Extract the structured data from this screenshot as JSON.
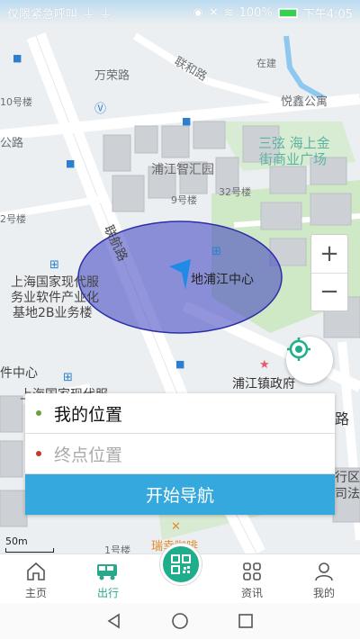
{
  "status_bar": {
    "left_text": "仅限紧急呼叫",
    "battery": "100%",
    "time": "下午4:05"
  },
  "map": {
    "labels": {
      "wanrong_rd": "万荣路",
      "lianhe_rd": "联和路",
      "zaijian": "在建",
      "yuemei": "悦鑫公寓",
      "gonglu": "公路",
      "haotong": "10号楼",
      "sanxian": "三弦 海上金",
      "jieshangye": "街商业广场",
      "pujiang_zhihui": "浦江智汇园",
      "bld9": "9号楼",
      "bld32": "32号楼",
      "lianhang_rd": "联航路",
      "bld2": "2号楼",
      "shanghai_guojia": "上海国家现代服",
      "wuye_ruanjian": "务业软件产业化",
      "jidi_2b": "基地2B业务楼",
      "pujiang_center": "地浦江中心",
      "jian_center": "件中心",
      "pujiang_gov": "浦江镇政府",
      "shanghai_xiandai": "上海国家现代服",
      "lu": "路",
      "xing_qu": "行区",
      "si_fa": "司法",
      "bld1": "1号楼",
      "ruixing": "瑞幸咖啡"
    },
    "zoom_in": "+",
    "zoom_out": "−",
    "scale": "50m"
  },
  "route_panel": {
    "start_value": "我的位置",
    "end_placeholder": "终点位置",
    "navigate_label": "开始导航"
  },
  "tabs": [
    {
      "label": "主页",
      "icon": "home-icon"
    },
    {
      "label": "出行",
      "icon": "bus-icon"
    },
    {
      "label": "资讯",
      "icon": "grid-icon"
    },
    {
      "label": "我的",
      "icon": "person-icon"
    }
  ],
  "colors": {
    "accent": "#1fae8b",
    "nav_button": "#35a9dd",
    "location_circle": "#3a3ec0"
  }
}
